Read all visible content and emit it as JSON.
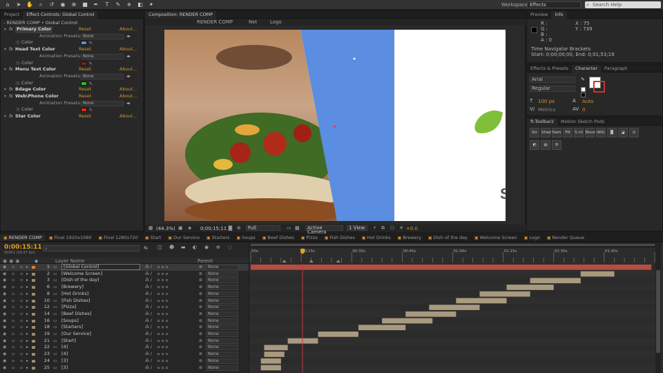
{
  "topbar": {
    "workspace_label": "Workspace:",
    "workspace_value": "Effects",
    "search_placeholder": "Search Help"
  },
  "left_panel": {
    "tabs": [
      "Project",
      "Effect Controls: Global Control"
    ],
    "header": "- RENDER COMP • Global Control",
    "reset": "Reset",
    "about": "About...",
    "anim_presets": "Animation Presets:",
    "none": "None",
    "color": "Color",
    "effects": [
      {
        "name": "Primary Color",
        "color": "#5b8de0"
      },
      {
        "name": "Head Text Color",
        "color": "#8a1c1c"
      },
      {
        "name": "Menu Text Color",
        "color": "#22c422"
      },
      {
        "name": "Bdage Color"
      },
      {
        "name": "Web\\Phone Color",
        "color": "#e8231d"
      },
      {
        "name": "Star Color"
      }
    ]
  },
  "viewer": {
    "tab": "Composition: RENDER COMP",
    "breadcrumbs": [
      "RENDER COMP",
      "Net",
      "Logo"
    ],
    "zoom": "(44.3%)",
    "timecode": "0;00;15;11",
    "resolution": "Full",
    "camera": "Active Camera",
    "views": "1 View",
    "exposure": "+0.0",
    "overlay_letter": "S"
  },
  "info_panel": {
    "tabs": [
      "Preview",
      "Info"
    ],
    "r": "R :",
    "g": "G :",
    "b": "B :",
    "a": "A : 0",
    "x": "X : 75",
    "y": "Y : 739",
    "line1": "Time Navigator Brackets",
    "line2": "Start: 0;00;00;00, End: 0;01;53;19"
  },
  "char_panel": {
    "tabs": [
      "Effects & Presets",
      "Character",
      "Paragraph"
    ],
    "font": "Arial",
    "style": "Regular",
    "size": "100 px",
    "leading": "Auto",
    "tracking": "Metrics",
    "kerning": "0"
  },
  "ft_panel": {
    "tabs": [
      "ft-Toolbar2",
      "Motion Sketch Pods"
    ],
    "buttons": [
      "Str",
      "Shad",
      "Ram",
      "Fill",
      "S ch",
      "Boun",
      "WIG"
    ]
  },
  "timeline": {
    "comp_tabs": [
      "RENDER COMP",
      "Final 1920x1080",
      "Final 1280x720",
      "Start",
      "Our Service",
      "Starters",
      "Soups",
      "Beef Dishes",
      "Pizza",
      "Fish Dishes",
      "Hot Drinks",
      "Brewery",
      "Dish of the day",
      "Welcome Screen",
      "Logo",
      "Render Queue"
    ],
    "timecode": "0:00:15:11",
    "fps": "00451 (29.97 fps)",
    "search_placeholder": "",
    "col_layer_name": "Layer Name",
    "col_parent": "Parent",
    "none": "None",
    "ruler": [
      "00s",
      "00:15s",
      "00:30s",
      "00:45s",
      "01:00s",
      "01:15s",
      "01:30s",
      "01:45s"
    ],
    "layers": [
      {
        "num": "1",
        "name": "[Global Control]"
      },
      {
        "num": "2",
        "name": "[Welcome Screen]"
      },
      {
        "num": "3",
        "name": "[Dish of the day]"
      },
      {
        "num": "6",
        "name": "[Brewery]"
      },
      {
        "num": "8",
        "name": "[Hot Drinks]"
      },
      {
        "num": "10",
        "name": "[Fish Dishes]"
      },
      {
        "num": "12",
        "name": "[Pizza]"
      },
      {
        "num": "14",
        "name": "[Beef Dishes]"
      },
      {
        "num": "16",
        "name": "[Soups]"
      },
      {
        "num": "18",
        "name": "[Starters]"
      },
      {
        "num": "19",
        "name": "[Our Service]"
      },
      {
        "num": "21",
        "name": "[Start]"
      },
      {
        "num": "22",
        "name": "[4]"
      },
      {
        "num": "23",
        "name": "[4]"
      },
      {
        "num": "24",
        "name": "[3]"
      },
      {
        "num": "25",
        "name": "[3]"
      }
    ],
    "bars_start_s": [
      0,
      98,
      83,
      76,
      68,
      61,
      53,
      46,
      39,
      32,
      20,
      11,
      4,
      4,
      3,
      3
    ],
    "bars_end_s": [
      119,
      108,
      98,
      90,
      83,
      76,
      68,
      61,
      54,
      46,
      32,
      20,
      11,
      10,
      9,
      9
    ],
    "playhead_s": 15.4,
    "colors": {
      "accent": "#e8a01c",
      "global_bar": "#b54d42",
      "layer_bar": "#a89a7e",
      "playhead": "#c23a3a"
    }
  }
}
